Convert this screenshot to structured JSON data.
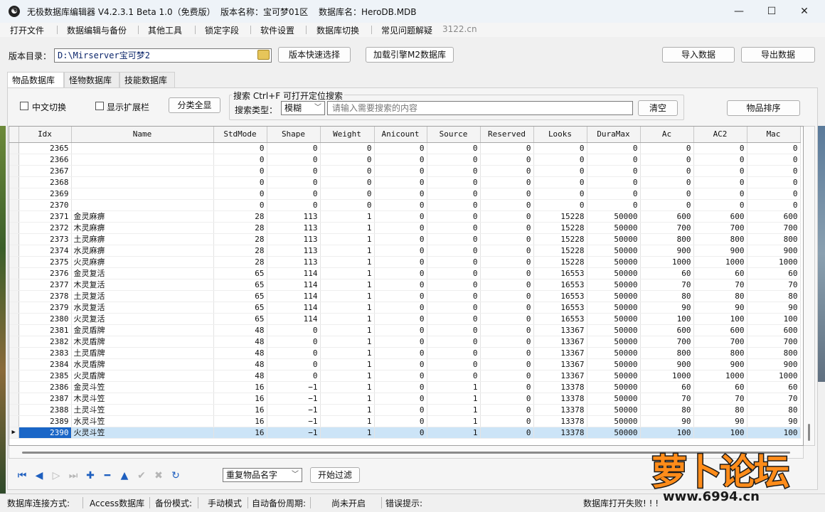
{
  "titlebar": {
    "app_name": "无极数据库编辑器 V4.2.3.1",
    "beta": "Beta 1.0（免费版）",
    "version_name": "版本名称：宝可梦01区",
    "db_name": "数据库名：HeroDB.MDB",
    "minimize": "—",
    "maximize": "☐",
    "close": "✕"
  },
  "menu": {
    "items": [
      "打开文件",
      "数据编辑与备份",
      "其他工具",
      "锁定字段",
      "软件设置",
      "数据库切换",
      "常见问题解疑"
    ],
    "hint": "3122.cn"
  },
  "toolbar": {
    "dir_label": "版本目录：",
    "dir_value": "D:\\Mirserver宝可梦2",
    "quick_select": "版本快速选择",
    "load_m2": "加载引擎M2数据库",
    "import": "导入数据",
    "export": "导出数据"
  },
  "tabs": [
    "物品数据库",
    "怪物数据库",
    "技能数据库"
  ],
  "filters": {
    "chinese_toggle": "中文切换",
    "show_extended": "显示扩展栏",
    "show_all_categories": "分类全显",
    "search_title": "搜索   Ctrl+F 可打开定位搜索",
    "search_type_label": "搜索类型：",
    "search_type_value": "模糊",
    "search_placeholder": "请输入需要搜索的内容",
    "clear": "清空",
    "sort": "物品排序"
  },
  "table": {
    "columns": [
      "Idx",
      "Name",
      "StdMode",
      "Shape",
      "Weight",
      "Anicount",
      "Source",
      "Reserved",
      "Looks",
      "DuraMax",
      "Ac",
      "AC2",
      "Mac"
    ],
    "rows": [
      [
        "2365",
        "",
        "0",
        "0",
        "0",
        "0",
        "0",
        "0",
        "0",
        "0",
        "0",
        "0",
        "0"
      ],
      [
        "2366",
        "",
        "0",
        "0",
        "0",
        "0",
        "0",
        "0",
        "0",
        "0",
        "0",
        "0",
        "0"
      ],
      [
        "2367",
        "",
        "0",
        "0",
        "0",
        "0",
        "0",
        "0",
        "0",
        "0",
        "0",
        "0",
        "0"
      ],
      [
        "2368",
        "",
        "0",
        "0",
        "0",
        "0",
        "0",
        "0",
        "0",
        "0",
        "0",
        "0",
        "0"
      ],
      [
        "2369",
        "",
        "0",
        "0",
        "0",
        "0",
        "0",
        "0",
        "0",
        "0",
        "0",
        "0",
        "0"
      ],
      [
        "2370",
        "",
        "0",
        "0",
        "0",
        "0",
        "0",
        "0",
        "0",
        "0",
        "0",
        "0",
        "0"
      ],
      [
        "2371",
        "金灵麻痹",
        "28",
        "113",
        "1",
        "0",
        "0",
        "0",
        "15228",
        "50000",
        "600",
        "600",
        "600"
      ],
      [
        "2372",
        "木灵麻痹",
        "28",
        "113",
        "1",
        "0",
        "0",
        "0",
        "15228",
        "50000",
        "700",
        "700",
        "700"
      ],
      [
        "2373",
        "土灵麻痹",
        "28",
        "113",
        "1",
        "0",
        "0",
        "0",
        "15228",
        "50000",
        "800",
        "800",
        "800"
      ],
      [
        "2374",
        "水灵麻痹",
        "28",
        "113",
        "1",
        "0",
        "0",
        "0",
        "15228",
        "50000",
        "900",
        "900",
        "900"
      ],
      [
        "2375",
        "火灵麻痹",
        "28",
        "113",
        "1",
        "0",
        "0",
        "0",
        "15228",
        "50000",
        "1000",
        "1000",
        "1000"
      ],
      [
        "2376",
        "金灵复活",
        "65",
        "114",
        "1",
        "0",
        "0",
        "0",
        "16553",
        "50000",
        "60",
        "60",
        "60"
      ],
      [
        "2377",
        "木灵复活",
        "65",
        "114",
        "1",
        "0",
        "0",
        "0",
        "16553",
        "50000",
        "70",
        "70",
        "70"
      ],
      [
        "2378",
        "土灵复活",
        "65",
        "114",
        "1",
        "0",
        "0",
        "0",
        "16553",
        "50000",
        "80",
        "80",
        "80"
      ],
      [
        "2379",
        "水灵复活",
        "65",
        "114",
        "1",
        "0",
        "0",
        "0",
        "16553",
        "50000",
        "90",
        "90",
        "90"
      ],
      [
        "2380",
        "火灵复活",
        "65",
        "114",
        "1",
        "0",
        "0",
        "0",
        "16553",
        "50000",
        "100",
        "100",
        "100"
      ],
      [
        "2381",
        "金灵盾牌",
        "48",
        "0",
        "1",
        "0",
        "0",
        "0",
        "13367",
        "50000",
        "600",
        "600",
        "600"
      ],
      [
        "2382",
        "木灵盾牌",
        "48",
        "0",
        "1",
        "0",
        "0",
        "0",
        "13367",
        "50000",
        "700",
        "700",
        "700"
      ],
      [
        "2383",
        "土灵盾牌",
        "48",
        "0",
        "1",
        "0",
        "0",
        "0",
        "13367",
        "50000",
        "800",
        "800",
        "800"
      ],
      [
        "2384",
        "水灵盾牌",
        "48",
        "0",
        "1",
        "0",
        "0",
        "0",
        "13367",
        "50000",
        "900",
        "900",
        "900"
      ],
      [
        "2385",
        "火灵盾牌",
        "48",
        "0",
        "1",
        "0",
        "0",
        "0",
        "13367",
        "50000",
        "1000",
        "1000",
        "1000"
      ],
      [
        "2386",
        "金灵斗笠",
        "16",
        "−1",
        "1",
        "0",
        "1",
        "0",
        "13378",
        "50000",
        "60",
        "60",
        "60"
      ],
      [
        "2387",
        "木灵斗笠",
        "16",
        "−1",
        "1",
        "0",
        "1",
        "0",
        "13378",
        "50000",
        "70",
        "70",
        "70"
      ],
      [
        "2388",
        "土灵斗笠",
        "16",
        "−1",
        "1",
        "0",
        "1",
        "0",
        "13378",
        "50000",
        "80",
        "80",
        "80"
      ],
      [
        "2389",
        "水灵斗笠",
        "16",
        "−1",
        "1",
        "0",
        "1",
        "0",
        "13378",
        "50000",
        "90",
        "90",
        "90"
      ],
      [
        "2390",
        "火灵斗笠",
        "16",
        "−1",
        "1",
        "0",
        "1",
        "0",
        "13378",
        "50000",
        "100",
        "100",
        "100"
      ]
    ],
    "selected_row_index": 25,
    "current_row_marker": "▶"
  },
  "navigator": {
    "buttons": [
      {
        "glyph": "⏮",
        "icon": "first-record-icon",
        "state": "enabled"
      },
      {
        "glyph": "◀",
        "icon": "prior-record-icon",
        "state": "enabled"
      },
      {
        "glyph": "▷",
        "icon": "next-record-icon",
        "state": "disabled"
      },
      {
        "glyph": "⏭",
        "icon": "last-record-icon",
        "state": "disabled"
      },
      {
        "glyph": "✚",
        "icon": "insert-record-icon",
        "state": "enabled"
      },
      {
        "glyph": "━",
        "icon": "delete-record-icon",
        "state": "enabled"
      },
      {
        "glyph": "▲",
        "icon": "edit-record-icon",
        "state": "enabled"
      },
      {
        "glyph": "✔",
        "icon": "post-record-icon",
        "state": "disabled"
      },
      {
        "glyph": "✖",
        "icon": "cancel-record-icon",
        "state": "disabled"
      },
      {
        "glyph": "↻",
        "icon": "refresh-record-icon",
        "state": "enabled"
      }
    ],
    "filter_select": "重复物品名字",
    "start_filter": "开始过滤"
  },
  "status": {
    "conn_label": "数据库连接方式:",
    "conn_value": "Access数据库",
    "backup_label": "备份模式:",
    "backup_value": "手动模式",
    "auto_label": "自动备份周期:",
    "auto_value": "尚未开启",
    "error_label": "错误提示:",
    "error_value": "数据库打开失败! ! !"
  },
  "watermark": {
    "title": "萝卜论坛",
    "url": "www.6994.cn"
  },
  "colors": {
    "selection": "#cce4f7",
    "selected_idx": "#1a66c7",
    "nav_blue": "#1e5fbf",
    "watermark_orange": "#ff8c1a"
  }
}
